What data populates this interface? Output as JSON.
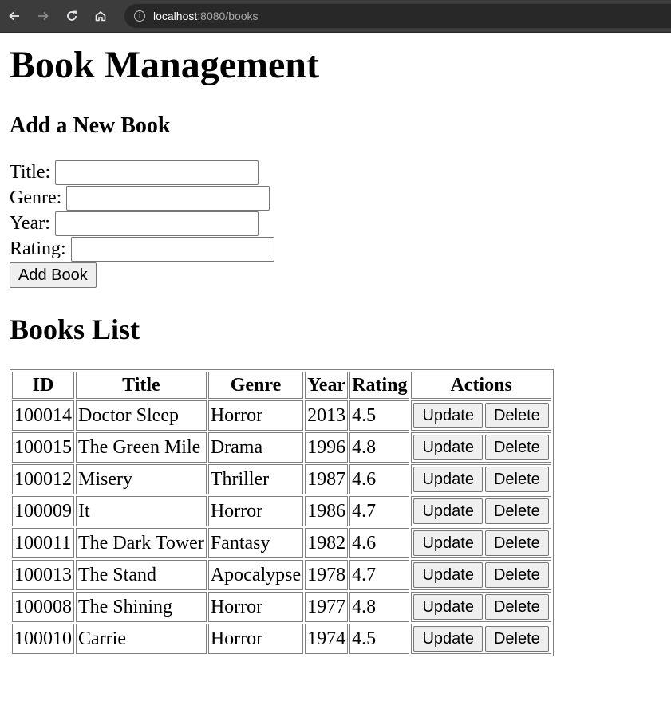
{
  "browser": {
    "url_host": "localhost",
    "url_rest": ":8080/books"
  },
  "page": {
    "title": "Book Management",
    "add_heading": "Add a New Book",
    "form": {
      "title_label": "Title:",
      "genre_label": "Genre:",
      "year_label": "Year:",
      "rating_label": "Rating:",
      "title_value": "",
      "genre_value": "",
      "year_value": "",
      "rating_value": "",
      "submit_label": "Add Book"
    },
    "list_heading": "Books List"
  },
  "table": {
    "headers": [
      "ID",
      "Title",
      "Genre",
      "Year",
      "Rating",
      "Actions"
    ],
    "rows": [
      {
        "id": "100014",
        "title": "Doctor Sleep",
        "genre": "Horror",
        "year": "2013",
        "rating": "4.5"
      },
      {
        "id": "100015",
        "title": "The Green Mile",
        "genre": "Drama",
        "year": "1996",
        "rating": "4.8"
      },
      {
        "id": "100012",
        "title": "Misery",
        "genre": "Thriller",
        "year": "1987",
        "rating": "4.6"
      },
      {
        "id": "100009",
        "title": "It",
        "genre": "Horror",
        "year": "1986",
        "rating": "4.7"
      },
      {
        "id": "100011",
        "title": "The Dark Tower",
        "genre": "Fantasy",
        "year": "1982",
        "rating": "4.6"
      },
      {
        "id": "100013",
        "title": "The Stand",
        "genre": "Apocalypse",
        "year": "1978",
        "rating": "4.7"
      },
      {
        "id": "100008",
        "title": "The Shining",
        "genre": "Horror",
        "year": "1977",
        "rating": "4.8"
      },
      {
        "id": "100010",
        "title": "Carrie",
        "genre": "Horror",
        "year": "1974",
        "rating": "4.5"
      }
    ],
    "update_label": "Update",
    "delete_label": "Delete"
  }
}
